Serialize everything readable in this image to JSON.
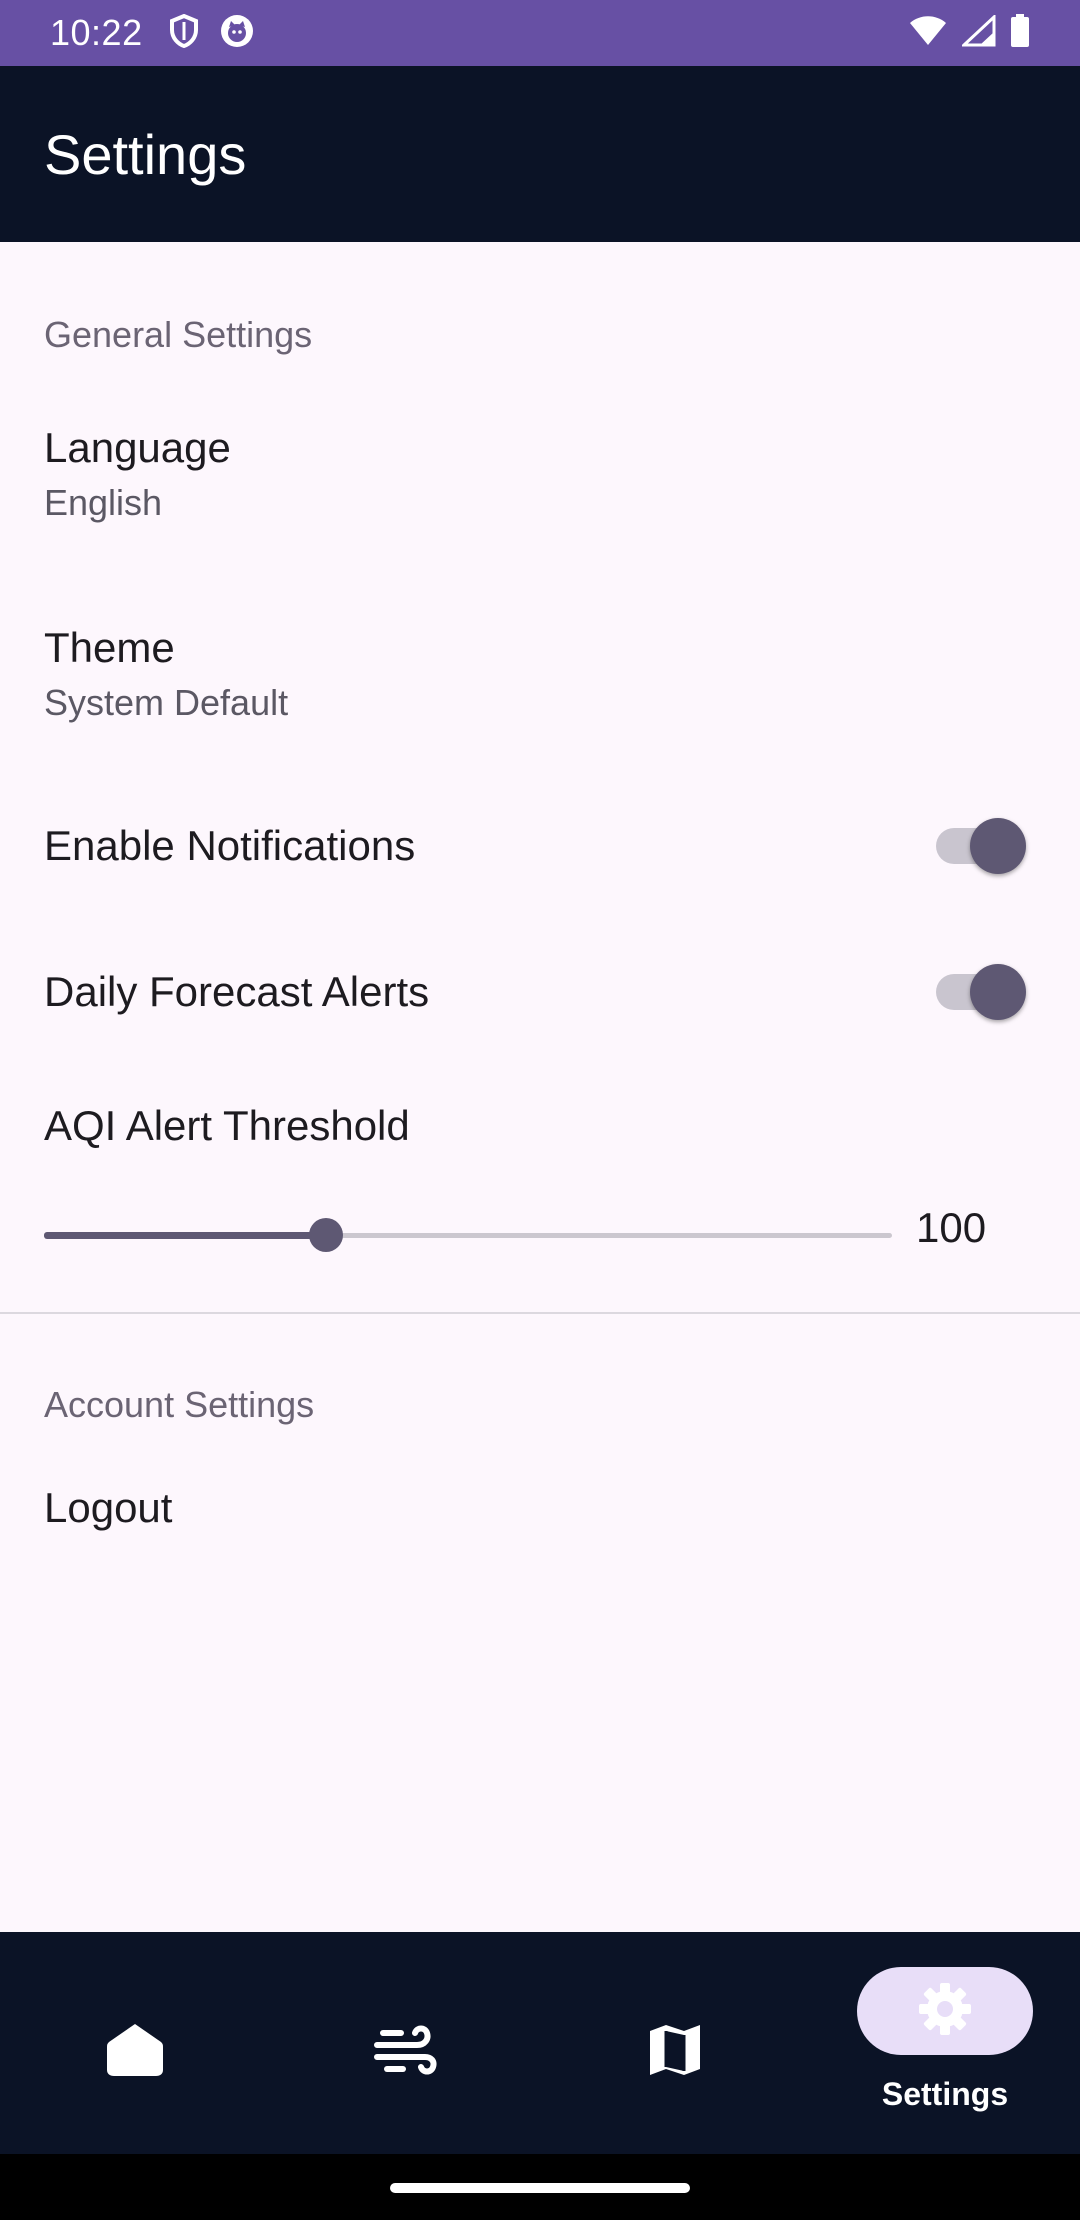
{
  "status_bar": {
    "time": "10:22",
    "icons_left": [
      "shield-icon",
      "cat-face-icon"
    ],
    "icons_right": [
      "wifi-icon",
      "signal-icon",
      "battery-icon"
    ],
    "color": "#6750a4"
  },
  "app_bar": {
    "title": "Settings",
    "background": "#0b1326"
  },
  "general": {
    "header": "General Settings",
    "language": {
      "title": "Language",
      "value": "English"
    },
    "theme": {
      "title": "Theme",
      "value": "System Default"
    },
    "notifications": {
      "title": "Enable Notifications",
      "enabled": true
    },
    "daily_alerts": {
      "title": "Daily Forecast Alerts",
      "enabled": true
    },
    "aqi_threshold": {
      "title": "AQI Alert Threshold",
      "value": "100",
      "fraction": 0.333
    }
  },
  "account": {
    "header": "Account Settings",
    "logout": "Logout"
  },
  "bottom_nav": {
    "items": [
      {
        "icon": "home-icon",
        "label": "",
        "selected": false
      },
      {
        "icon": "wind-icon",
        "label": "",
        "selected": false
      },
      {
        "icon": "map-icon",
        "label": "",
        "selected": false
      },
      {
        "icon": "gear-icon",
        "label": "Settings",
        "selected": true
      }
    ],
    "indicator_color": "#e8def8"
  }
}
